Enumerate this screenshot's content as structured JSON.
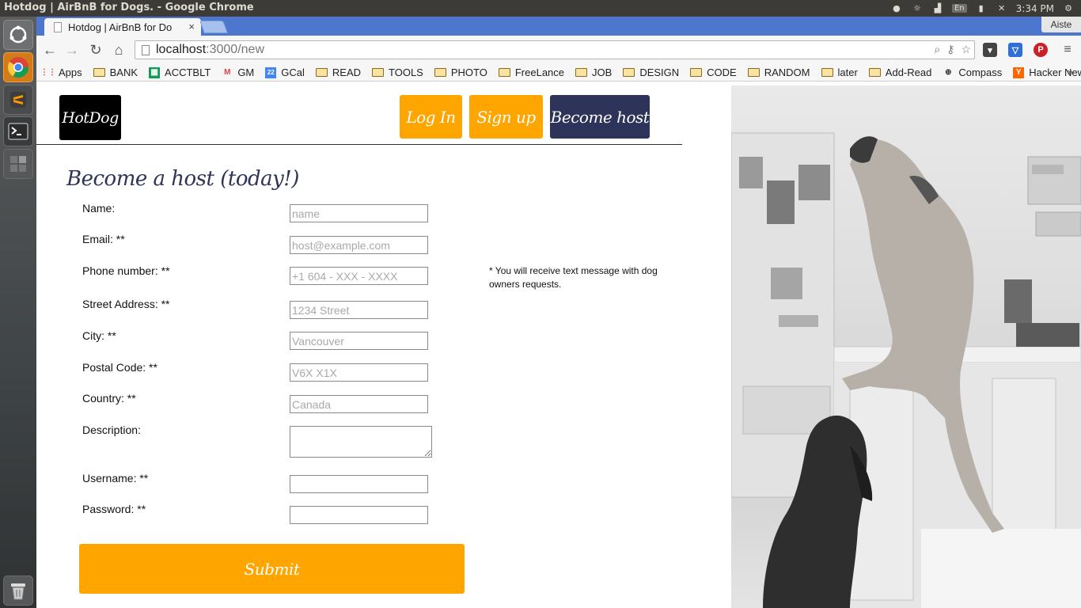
{
  "os": {
    "window_title": "Hotdog | AirBnB for Dogs. - Google Chrome",
    "keyboard_layout": "En",
    "clock": "3:34 PM"
  },
  "browser": {
    "tab_title": "Hotdog | AirBnB for Do",
    "tab_close": "×",
    "profile_name": "Aiste",
    "url_host": "localhost",
    "url_path": ":3000/new",
    "bookmarks": [
      "Apps",
      "BANK",
      "ACCTBLT",
      "GM",
      "GCal",
      "READ",
      "TOOLS",
      "PHOTO",
      "FreeLance",
      "JOB",
      "DESIGN",
      "CODE",
      "RANDOM",
      "later",
      "Add-Read",
      "Compass",
      "Hacker News"
    ],
    "bookmarks_overflow": "»"
  },
  "nav": {
    "logo": "HotDog",
    "login": "Log In",
    "signup": "Sign up",
    "become_host": "Become host"
  },
  "form": {
    "heading": "Become a host (today!)",
    "fields": [
      {
        "label": "Name:",
        "placeholder": "name"
      },
      {
        "label": "Email: **",
        "placeholder": "host@example.com"
      },
      {
        "label": "Phone number: **",
        "placeholder": "+1 604 - XXX - XXXX"
      },
      {
        "label": "Street Address: **",
        "placeholder": "1234 Street"
      },
      {
        "label": "City: **",
        "placeholder": "Vancouver"
      },
      {
        "label": "Postal Code: **",
        "placeholder": "V6X X1X"
      },
      {
        "label": "Country: **",
        "placeholder": "Canada"
      },
      {
        "label": "Description:",
        "placeholder": ""
      },
      {
        "label": "Username: **",
        "placeholder": ""
      },
      {
        "label": "Password: **",
        "placeholder": ""
      }
    ],
    "phone_note": "* You will receive text message with dog owners requests.",
    "submit": "Submit"
  },
  "colors": {
    "accent_orange": "#ffa500",
    "accent_navy": "#2e3459",
    "logo_bg": "#000000"
  }
}
